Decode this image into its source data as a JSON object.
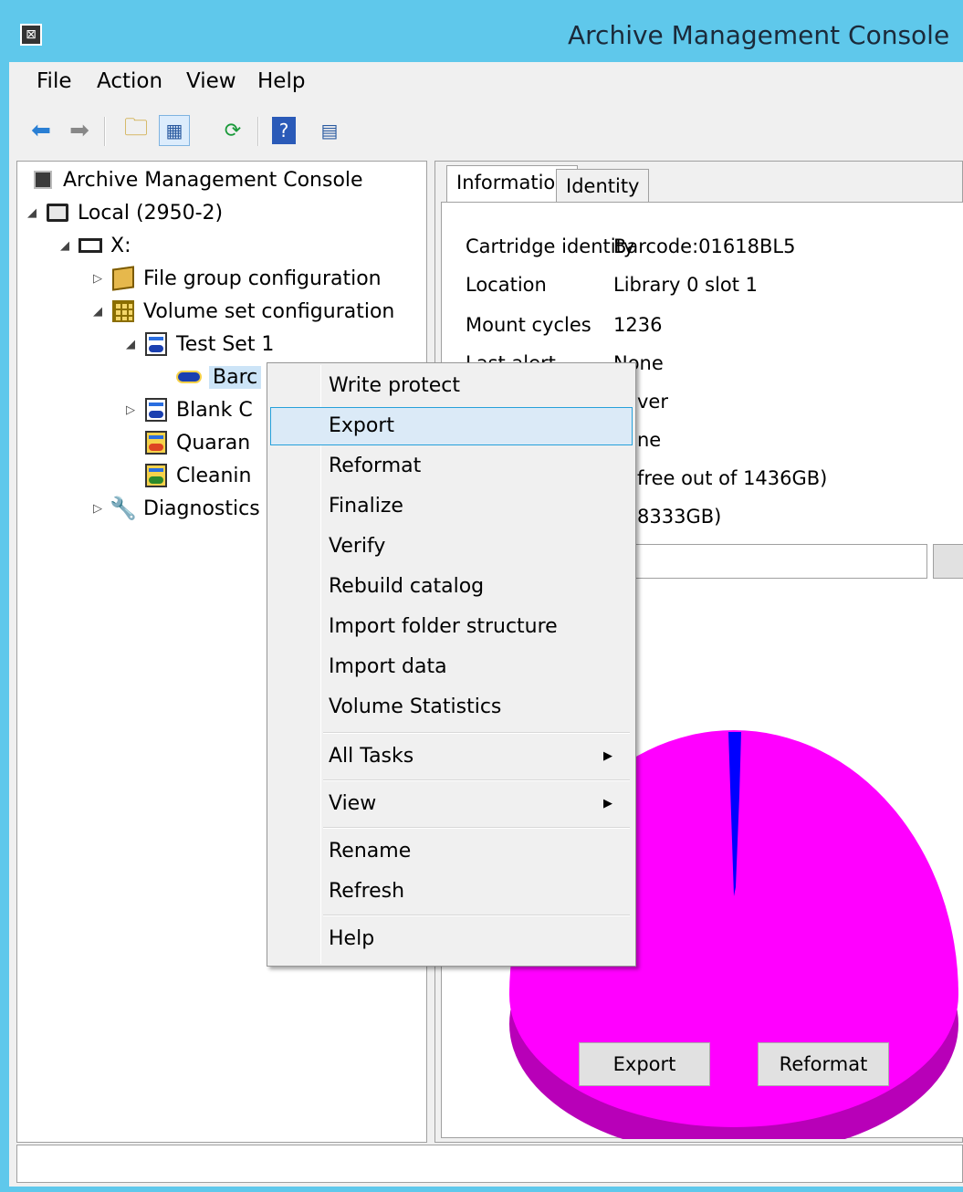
{
  "window": {
    "title": "Archive Management Console"
  },
  "menubar": [
    "File",
    "Action",
    "View",
    "Help"
  ],
  "toolbar": {
    "icons": [
      "back-arrow-icon",
      "forward-arrow-icon",
      "up-folder-icon",
      "show-hide-tree-icon",
      "refresh-icon",
      "help-icon",
      "properties-icon"
    ]
  },
  "tree": {
    "root": "Archive Management Console",
    "local": "Local (2950-2)",
    "drive": "X:",
    "file_group": "File group configuration",
    "volume_set": "Volume set configuration",
    "test_set": "Test Set 1",
    "barcode": "Barc",
    "blank": "Blank C",
    "quarantine": "Quaran",
    "cleaning": "Cleanin",
    "diagnostics": "Diagnostics"
  },
  "tabs": [
    "Information",
    "Identity"
  ],
  "info": [
    {
      "label": "Cartridge identity",
      "value": "Barcode:01618BL5"
    },
    {
      "label": "Location",
      "value": "Library 0 slot 1"
    },
    {
      "label": "Mount cycles",
      "value": "1236"
    },
    {
      "label": "Last alert",
      "value": "None"
    }
  ],
  "info_partial": [
    "ver",
    "ne",
    "free out of 1436GB)",
    "8333GB)"
  ],
  "buttons": {
    "export": "Export",
    "reformat": "Reformat"
  },
  "context_menu": {
    "items": [
      {
        "label": "Write protect"
      },
      {
        "label": "Export",
        "highlighted": true
      },
      {
        "label": "Reformat"
      },
      {
        "label": "Finalize"
      },
      {
        "label": "Verify"
      },
      {
        "label": "Rebuild catalog"
      },
      {
        "label": "Import folder structure"
      },
      {
        "label": "Import data"
      },
      {
        "label": "Volume Statistics"
      },
      {
        "label": "All Tasks",
        "submenu": true
      },
      {
        "label": "View",
        "submenu": true
      },
      {
        "label": "Rename"
      },
      {
        "label": "Refresh"
      },
      {
        "label": "Help"
      }
    ]
  },
  "colors": {
    "title_bar": "#5fc8eb",
    "pie_free": "#ff00ff",
    "pie_used": "#0000ff",
    "menu_highlight": "#dbeaf7"
  }
}
